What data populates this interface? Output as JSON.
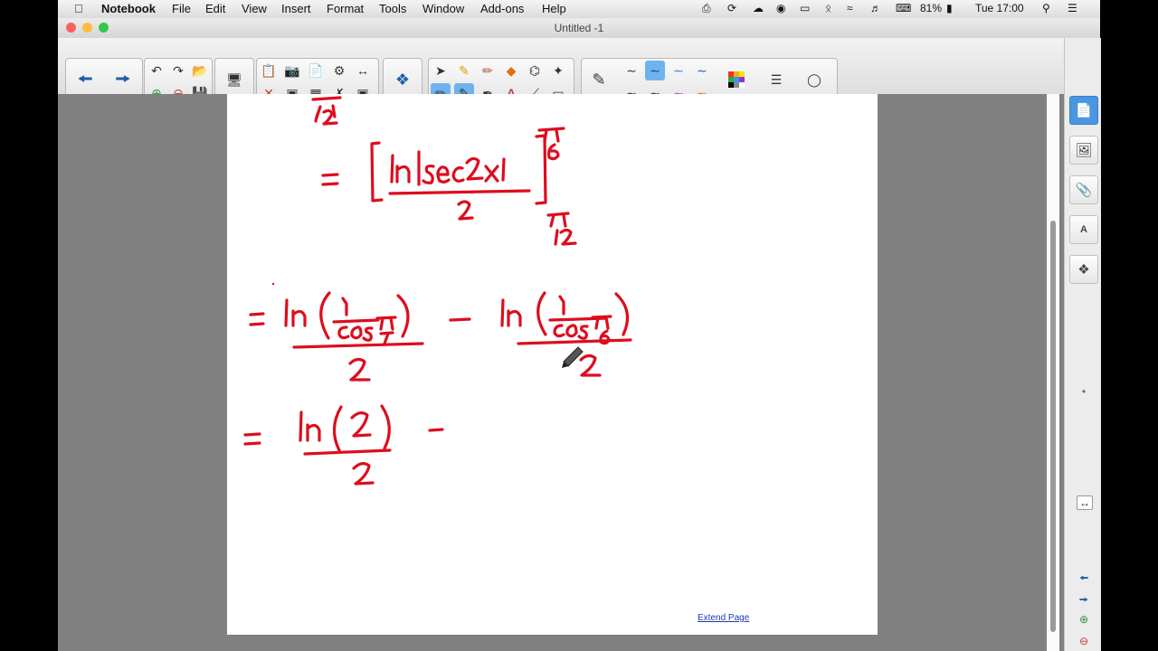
{
  "menubar": {
    "apple_icon": "apple-icon",
    "app_name": "Notebook",
    "items": [
      "File",
      "Edit",
      "View",
      "Insert",
      "Format",
      "Tools",
      "Window",
      "Add-ons",
      "Help"
    ],
    "battery": "81%",
    "clock": "Tue 17:00"
  },
  "window": {
    "title": "Untitled -1",
    "traffic_colors": [
      "#fc605c",
      "#fdbc40",
      "#34c84a"
    ]
  },
  "toolbar": {
    "pen_colors": [
      "#222222",
      "#2a7de1",
      "#cc3333",
      "#1a9a3a",
      "#e07010",
      "#9b30c8"
    ]
  },
  "page": {
    "extend_label": "Extend Page",
    "ink_color": "#dd0d1e"
  },
  "sidebar": {
    "tabs": [
      "page-sorter-icon",
      "gallery-icon",
      "attachments-icon",
      "properties-icon",
      "add-ons-icon"
    ]
  }
}
